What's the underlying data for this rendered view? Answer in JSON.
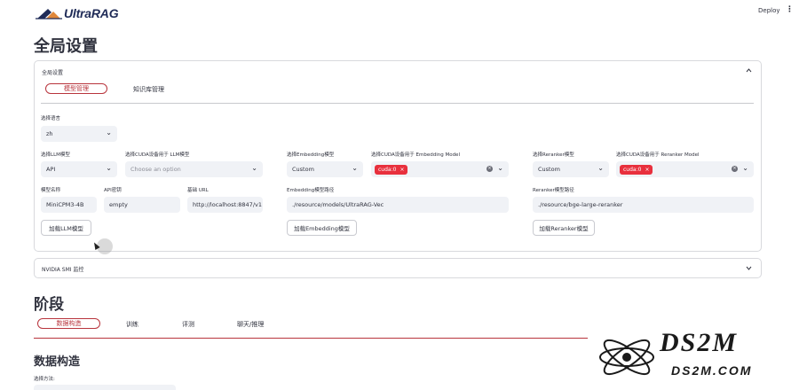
{
  "app": {
    "logo_text": "UltraRAG",
    "deploy_label": "Deploy",
    "menu_glyph": "⋮"
  },
  "global": {
    "title": "全局设置",
    "expander_label": "全局设置",
    "tabs": [
      {
        "label": "模型管理",
        "active": true
      },
      {
        "label": "知识库管理",
        "active": false
      }
    ],
    "language": {
      "label": "选择语言",
      "value": "zh"
    },
    "llm": {
      "model_select_label": "选择LLM模型",
      "model_value": "API",
      "cuda_label": "选择CUDA设备用于 LLM模型",
      "cuda_placeholder": "Choose an option",
      "name_label": "模型名称",
      "name_value": "MiniCPM3-4B",
      "key_label": "API密钥",
      "key_value": "empty",
      "url_label": "基础 URL",
      "url_value": "http://localhost:8847/v1",
      "load_button": "加载LLM模型"
    },
    "embedding": {
      "model_select_label": "选择Embedding模型",
      "model_value": "Custom",
      "cuda_label": "选择CUDA设备用于 Embedding Model",
      "cuda_tag": "cuda:0",
      "path_label": "Embedding模型路径",
      "path_value": "./resource/models/UltraRAG-Vec",
      "load_button": "加载Embedding模型"
    },
    "reranker": {
      "model_select_label": "选择Reranker模型",
      "model_value": "Custom",
      "cuda_label": "选择CUDA设备用于 Reranker Model",
      "cuda_tag": "cuda:0",
      "path_label": "Reranker模型路径",
      "path_value": "./resource/bge-large-reranker",
      "load_button": "加载Reranker模型"
    },
    "nvidia_label": "NVIDIA SMI 监控"
  },
  "stage": {
    "title": "阶段",
    "tabs": [
      {
        "label": "数据构造",
        "active": true
      },
      {
        "label": "训练",
        "active": false
      },
      {
        "label": "评测",
        "active": false
      },
      {
        "label": "聊天/推理",
        "active": false
      }
    ],
    "section_title": "数据构造",
    "method_label": "选择方法:"
  },
  "watermark": {
    "title": "DS2M",
    "subtitle": "DS2M.COM"
  },
  "colors": {
    "accent": "#b8343c",
    "tag_red": "#e8303d",
    "field_bg": "#f0f2f6",
    "text": "#31333f"
  },
  "icons": {
    "chevron_up": "⌃",
    "chevron_down": "⌄",
    "remove": "×"
  }
}
